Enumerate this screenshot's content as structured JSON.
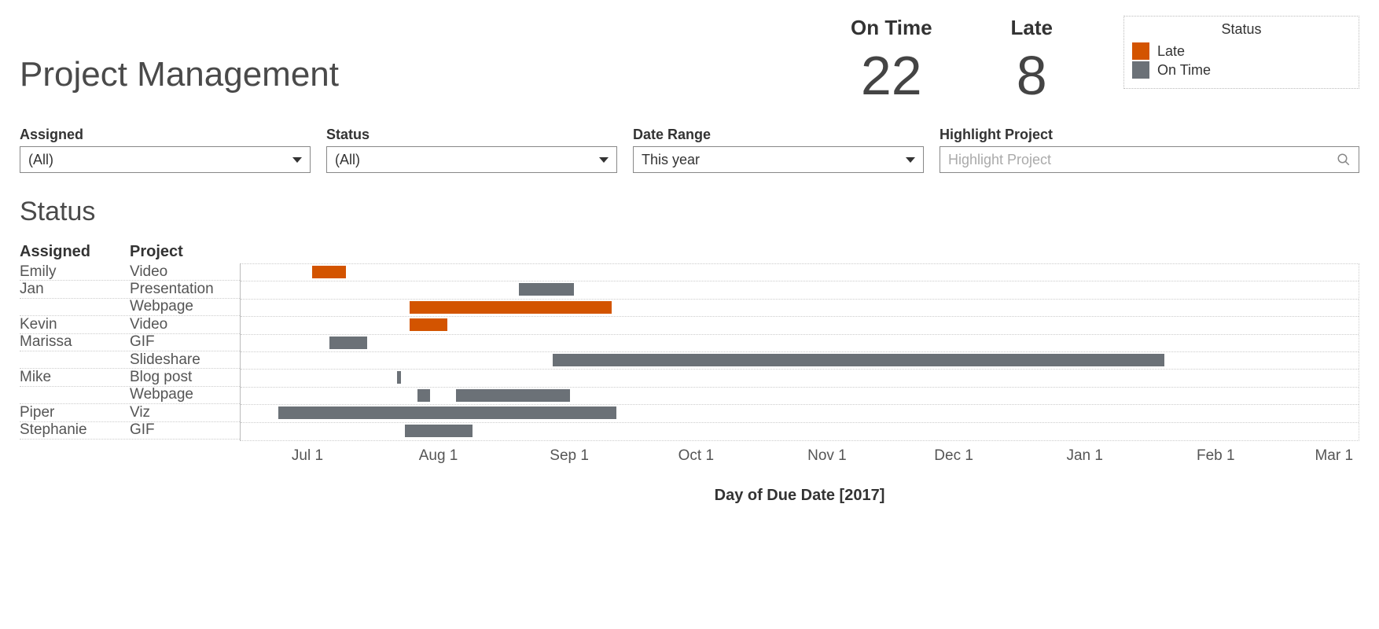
{
  "title": "Project Management",
  "kpis": [
    {
      "label": "On Time",
      "value": "22"
    },
    {
      "label": "Late",
      "value": "8"
    }
  ],
  "legend": {
    "title": "Status",
    "items": [
      {
        "label": "Late",
        "color": "#d35400"
      },
      {
        "label": "On Time",
        "color": "#6b7177"
      }
    ]
  },
  "filters": {
    "assigned": {
      "label": "Assigned",
      "value": "(All)"
    },
    "status": {
      "label": "Status",
      "value": "(All)"
    },
    "date_range": {
      "label": "Date Range",
      "value": "This year"
    },
    "highlight": {
      "label": "Highlight Project",
      "placeholder": "Highlight Project"
    }
  },
  "gantt": {
    "section_title": "Status",
    "col_assigned": "Assigned",
    "col_project": "Project",
    "xaxis_title": "Day of Due Date [2017]",
    "ticks": [
      "Jul 1",
      "Aug 1",
      "Sep 1",
      "Oct 1",
      "Nov 1",
      "Dec 1",
      "Jan 1",
      "Feb 1",
      "Mar 1"
    ],
    "rows": [
      {
        "assigned": "Emily",
        "project": "Video"
      },
      {
        "assigned": "Jan",
        "project": "Presentation"
      },
      {
        "assigned": "",
        "project": "Webpage"
      },
      {
        "assigned": "Kevin",
        "project": "Video"
      },
      {
        "assigned": "Marissa",
        "project": "GIF"
      },
      {
        "assigned": "",
        "project": "Slideshare"
      },
      {
        "assigned": "Mike",
        "project": "Blog post"
      },
      {
        "assigned": "",
        "project": "Webpage"
      },
      {
        "assigned": "Piper",
        "project": "Viz"
      },
      {
        "assigned": "Stephanie",
        "project": "GIF"
      }
    ]
  },
  "colors": {
    "late": "#d35400",
    "ontime": "#6b7177"
  },
  "chart_data": {
    "type": "bar",
    "title": "Status",
    "xlabel": "Day of Due Date [2017]",
    "ylabel": "",
    "x_range": [
      "2017-06-15",
      "2018-03-07"
    ],
    "x_ticks": [
      "2017-07-01",
      "2017-08-01",
      "2017-09-01",
      "2017-10-01",
      "2017-11-01",
      "2017-12-01",
      "2018-01-01",
      "2018-02-01",
      "2018-03-01"
    ],
    "series": [
      {
        "assigned": "Emily",
        "project": "Video",
        "start": "2017-07-02",
        "end": "2017-07-10",
        "status": "Late"
      },
      {
        "assigned": "Jan",
        "project": "Presentation",
        "start": "2017-08-20",
        "end": "2017-09-02",
        "status": "On Time"
      },
      {
        "assigned": "Jan",
        "project": "Webpage",
        "start": "2017-07-25",
        "end": "2017-09-11",
        "status": "Late"
      },
      {
        "assigned": "Kevin",
        "project": "Video",
        "start": "2017-07-25",
        "end": "2017-08-03",
        "status": "Late"
      },
      {
        "assigned": "Marissa",
        "project": "GIF",
        "start": "2017-07-06",
        "end": "2017-07-15",
        "status": "On Time"
      },
      {
        "assigned": "Marissa",
        "project": "Slideshare",
        "start": "2017-08-28",
        "end": "2018-01-20",
        "status": "On Time"
      },
      {
        "assigned": "Mike",
        "project": "Blog post",
        "start": "2017-07-22",
        "end": "2017-07-23",
        "status": "On Time"
      },
      {
        "assigned": "Mike",
        "project": "Webpage",
        "start": "2017-07-27",
        "end": "2017-07-30",
        "status": "On Time"
      },
      {
        "assigned": "Mike",
        "project": "Webpage",
        "start": "2017-08-05",
        "end": "2017-09-01",
        "status": "On Time"
      },
      {
        "assigned": "Piper",
        "project": "Viz",
        "start": "2017-06-24",
        "end": "2017-09-12",
        "status": "On Time"
      },
      {
        "assigned": "Stephanie",
        "project": "GIF",
        "start": "2017-07-24",
        "end": "2017-08-09",
        "status": "On Time"
      }
    ]
  }
}
